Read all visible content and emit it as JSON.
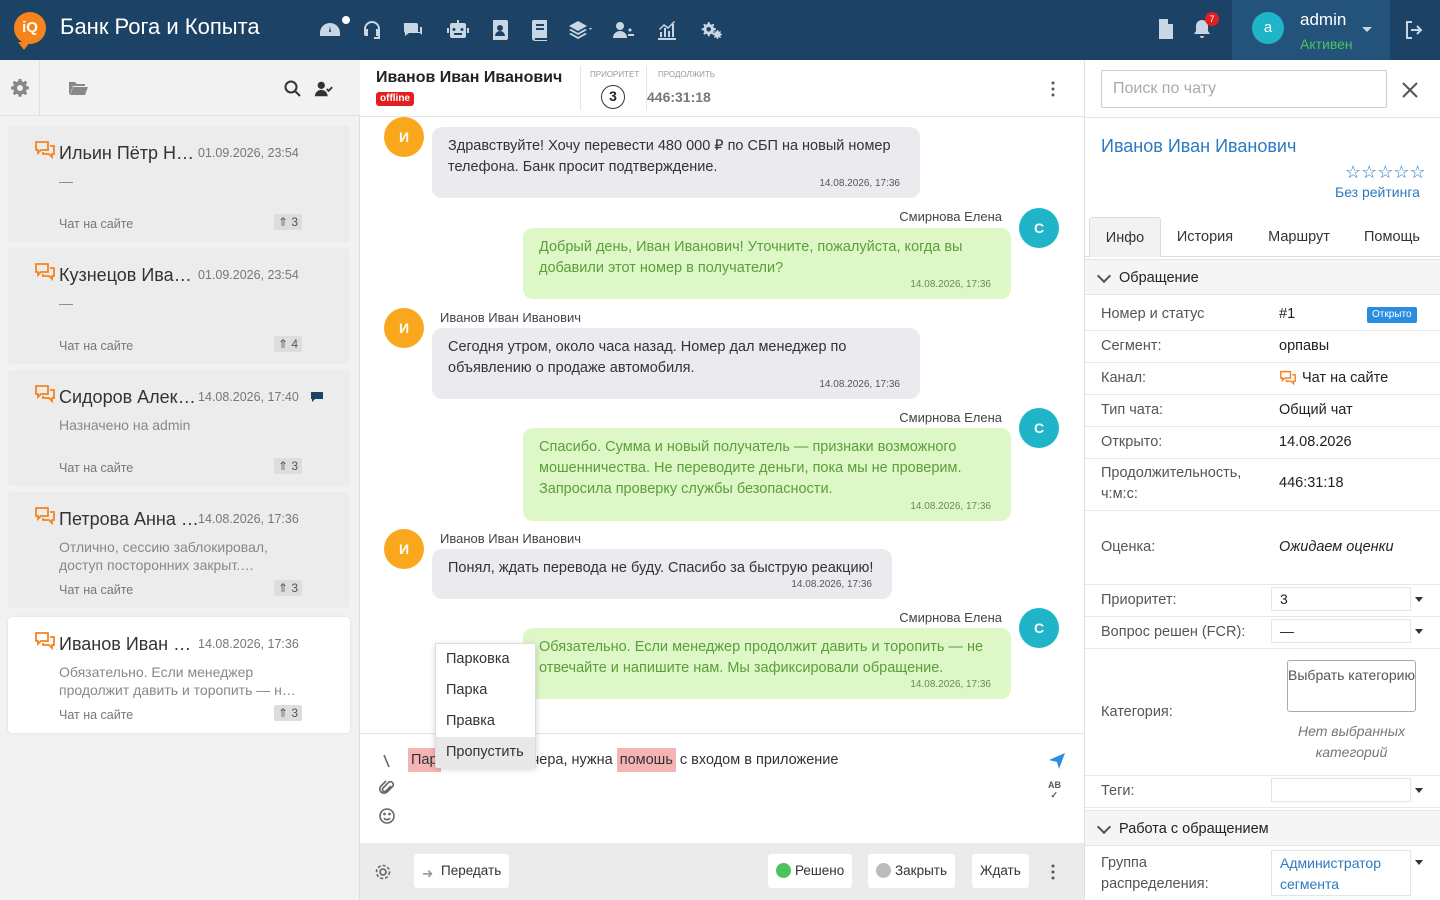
{
  "app": {
    "title": "Банк Рога и Копыта",
    "logo_text": "iQ"
  },
  "topbar": {
    "nav_icons": [
      "dashboard-icon",
      "headset-icon",
      "chats-icon",
      "robot-icon",
      "contacts-icon",
      "book-icon",
      "layers-icon",
      "users-icon",
      "stats-icon",
      "settings-icon"
    ],
    "notifications_count": "7",
    "user": {
      "avatar_letter": "a",
      "name": "admin",
      "status": "Активен"
    }
  },
  "chat_list": [
    {
      "name": "Ильин Пётр Ни…",
      "date": "01.09.2026, 23:54",
      "preview": "—",
      "channel": "Чат на сайте",
      "priority": "3",
      "active": false
    },
    {
      "name": "Кузнецов Иван…",
      "date": "01.09.2026, 23:54",
      "preview": "—",
      "channel": "Чат на сайте",
      "priority": "4",
      "active": false
    },
    {
      "name": "Сидоров Алекс…",
      "date": "14.08.2026, 17:40",
      "preview": "Назначено на admin",
      "channel": "Чат на сайте",
      "priority": "3",
      "active": false
    },
    {
      "name": "Петрова Анна …",
      "date": "14.08.2026, 17:36",
      "preview": "Отлично, сессию заблокировал, доступ посторонних закрыт.…",
      "channel": "Чат на сайте",
      "priority": "3",
      "active": false
    },
    {
      "name": "Иванов Иван И…",
      "date": "14.08.2026, 17:36",
      "preview": "Обязательно. Если менеджер продолжит давить и торопить — н…",
      "channel": "Чат на сайте",
      "priority": "3",
      "active": true
    }
  ],
  "chat_header": {
    "name": "Иванов Иван Иванович",
    "status": "offline",
    "priority_label": "приоритет",
    "priority": "3",
    "duration_label": "продолжить",
    "duration": "446:31:18"
  },
  "messages": [
    {
      "from": "client",
      "author": "Иванов Иван Иванович",
      "avatar": "И",
      "text": "Здравствуйте! Хочу перевести 480 000 ₽ по СБП на новый номер телефона. Банк просит подтверждение.",
      "time": "14.08.2026, 17:36"
    },
    {
      "from": "agent",
      "author": "Смирнова Елена",
      "avatar": "С",
      "text": "Добрый день, Иван Иванович! Уточните, пожалуйста, когда вы добавили этот номер в получатели?",
      "time": "14.08.2026, 17:36"
    },
    {
      "from": "client",
      "author": "Иванов Иван Иванович",
      "avatar": "И",
      "text": "Сегодня утром, около часа назад. Номер дал менеджер по объявлению о продаже автомобиля.",
      "time": "14.08.2026, 17:36"
    },
    {
      "from": "agent",
      "author": "Смирнова Елена",
      "avatar": "С",
      "text": "Спасибо. Сумма и новый получатель — признаки возможного мошенничества. Не переводите деньги, пока мы не проверим. Запросила проверку службы безопасности.",
      "time": "14.08.2026, 17:36"
    },
    {
      "from": "client",
      "author": "Иванов Иван Иванович",
      "avatar": "И",
      "text": "Понял, ждать перевода не буду. Спасибо за быструю реакцию!",
      "time": "14.08.2026, 17:36"
    },
    {
      "from": "agent",
      "author": "Смирнова Елена",
      "avatar": "С",
      "text": "Обязательно. Если менеджер продолжит давить и торопить — не отвечайте и напишите нам. Мы зафиксировали обращение.",
      "time": "14.08.2026, 17:36"
    }
  ],
  "composer": {
    "text_before": "Пар",
    "text_mid": "а вчера, нужна",
    "text_err2": "помошь",
    "text_after": "с входом в приложение",
    "spell_suggestions": [
      "Парковка",
      "Парка",
      "Правка",
      "Пропустить"
    ]
  },
  "bottom_bar": {
    "transfer": "Передать",
    "resolved": "Решено",
    "close": "Закрыть",
    "wait": "Ждать"
  },
  "right_panel": {
    "search_placeholder": "Поиск по чату",
    "client_name": "Иванов Иван Иванович",
    "stars": "☆☆☆☆☆",
    "no_rating": "Без рейтинга",
    "tabs": [
      "Инфо",
      "История",
      "Маршрут",
      "Помощь"
    ],
    "section_appeal": "Обращение",
    "fields": {
      "number_status_label": "Номер и статус",
      "number": "#1",
      "status_badge": "Открыто",
      "segment_label": "Сегмент:",
      "segment": "орпавы",
      "channel_label": "Канал:",
      "channel": "Чат на сайте",
      "chat_type_label": "Тип чата:",
      "chat_type": "Общий чат",
      "opened_label": "Открыто:",
      "opened": "14.08.2026",
      "duration_label": "Продолжительность, ч:м:с:",
      "duration": "446:31:18",
      "rating_label": "Оценка:",
      "rating": "Ожидаем оценки",
      "priority_label": "Приоритет:",
      "priority": "3",
      "fcr_label": "Вопрос решен (FCR):",
      "fcr": "—",
      "category_label": "Категория:",
      "category_button": "Выбрать категорию",
      "no_categories": "Нет выбранных категорий",
      "tags_label": "Теги:",
      "tags": ""
    },
    "section_work": "Работа с обращением",
    "group_label": "Группа распределения:",
    "group_value": "Администратор сегмента"
  },
  "colors": {
    "topbar": "#1c4366",
    "accent": "#2a7ac0",
    "agent_bubble": "#ddf7c7",
    "client_bubble": "#ebebef",
    "client_avatar": "#f9a81d",
    "agent_avatar": "#1fb4c8",
    "offline": "#e02020"
  }
}
